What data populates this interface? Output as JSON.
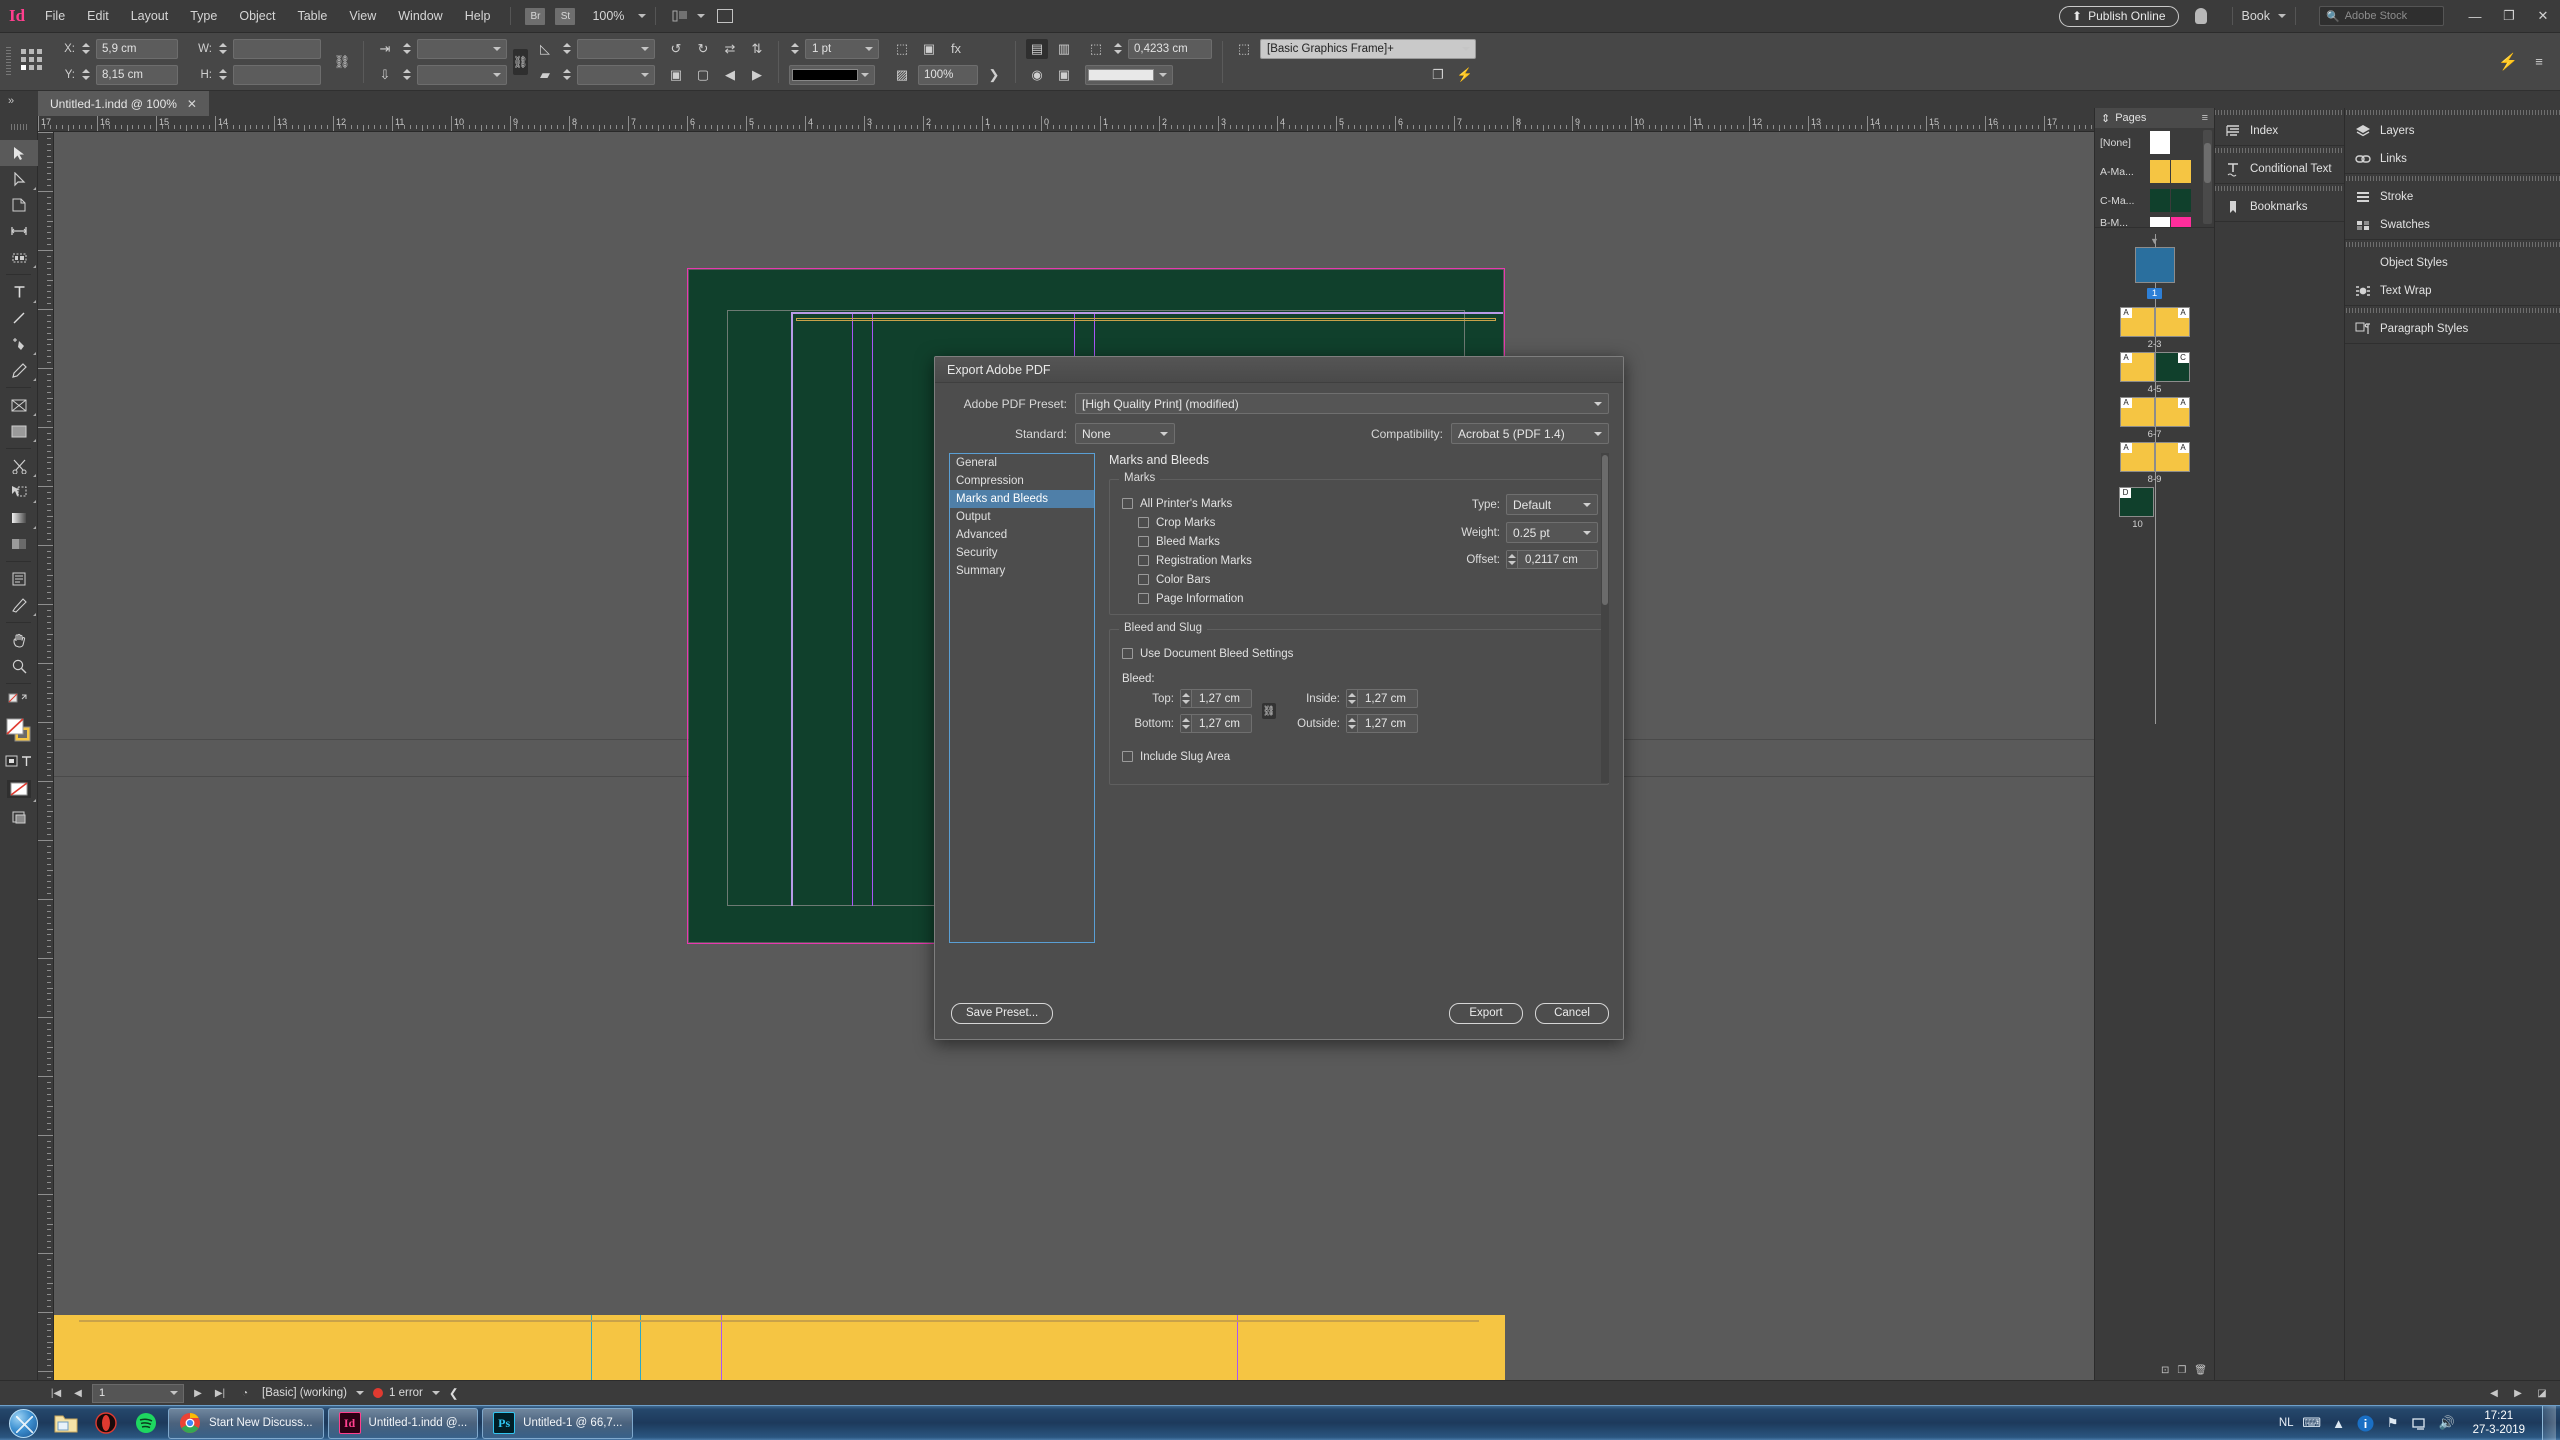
{
  "app": {
    "logo": "Id",
    "menus": [
      "File",
      "Edit",
      "Layout",
      "Type",
      "Object",
      "Table",
      "View",
      "Window",
      "Help"
    ],
    "bridge_label": "Br",
    "stock_label": "St",
    "zoom_level": "100%",
    "publish_button": "Publish Online",
    "workspace": "Book",
    "search_placeholder": "Adobe Stock",
    "window_minimize": "—",
    "window_restore": "❐",
    "window_close": "✕"
  },
  "control_bar": {
    "x_label": "X:",
    "x_value": "5,9 cm",
    "y_label": "Y:",
    "y_value": "8,15 cm",
    "w_label": "W:",
    "w_value": "",
    "h_label": "H:",
    "h_value": "",
    "scale_x": "",
    "scale_y": "",
    "rotation": "",
    "shear": "",
    "stroke_weight": "1 pt",
    "opacity": "100%",
    "corner_radius": "0,4233 cm",
    "object_style": "[Basic Graphics Frame]+",
    "stroke_swatch": "#000000"
  },
  "document_tab": {
    "title": "Untitled-1.indd @ 100%",
    "close": "✕"
  },
  "ruler": {
    "horizontal_labels": [
      "17",
      "16",
      "15",
      "14",
      "13",
      "12",
      "11",
      "10",
      "9",
      "8",
      "7",
      "6",
      "5",
      "4",
      "3",
      "2",
      "1",
      "0",
      "1",
      "2",
      "3",
      "4",
      "5",
      "6",
      "7",
      "8",
      "9",
      "10",
      "11",
      "12",
      "13",
      "14",
      "15",
      "16",
      "17"
    ],
    "unit": "cm"
  },
  "toolbox": {
    "tools": [
      {
        "name": "selection-tool",
        "glyph": "➤"
      },
      {
        "name": "direct-selection-tool",
        "glyph": "◹"
      },
      {
        "name": "page-tool",
        "glyph": "▤"
      },
      {
        "name": "gap-tool",
        "glyph": "↔"
      },
      {
        "name": "content-collector-tool",
        "glyph": "▩"
      },
      {
        "name": "type-tool",
        "glyph": "T"
      },
      {
        "name": "line-tool",
        "glyph": "/"
      },
      {
        "name": "pen-tool",
        "glyph": "✒"
      },
      {
        "name": "pencil-tool",
        "glyph": "✎"
      },
      {
        "name": "rectangle-frame-tool",
        "glyph": "⊠"
      },
      {
        "name": "rectangle-tool",
        "glyph": "▭"
      },
      {
        "name": "scissors-tool",
        "glyph": "✂"
      },
      {
        "name": "free-transform-tool",
        "glyph": "⇲"
      },
      {
        "name": "gradient-swatch-tool",
        "glyph": "▰"
      },
      {
        "name": "gradient-feather-tool",
        "glyph": "▨"
      },
      {
        "name": "note-tool",
        "glyph": "▤"
      },
      {
        "name": "eyedropper-tool",
        "glyph": "⚲"
      },
      {
        "name": "hand-tool",
        "glyph": "✋"
      },
      {
        "name": "zoom-tool",
        "glyph": "⚲"
      }
    ]
  },
  "dialog": {
    "title": "Export Adobe PDF",
    "preset_label": "Adobe PDF Preset:",
    "preset_value": "[High Quality Print] (modified)",
    "standard_label": "Standard:",
    "standard_value": "None",
    "compatibility_label": "Compatibility:",
    "compatibility_value": "Acrobat 5 (PDF 1.4)",
    "nav_items": [
      "General",
      "Compression",
      "Marks and Bleeds",
      "Output",
      "Advanced",
      "Security",
      "Summary"
    ],
    "active_nav": "Marks and Bleeds",
    "pane_title": "Marks and Bleeds",
    "marks_group_label": "Marks",
    "marks": [
      {
        "label": "All Printer's Marks",
        "checked": false,
        "indent": 0
      },
      {
        "label": "Crop Marks",
        "checked": false,
        "indent": 1
      },
      {
        "label": "Bleed Marks",
        "checked": false,
        "indent": 1
      },
      {
        "label": "Registration Marks",
        "checked": false,
        "indent": 1
      },
      {
        "label": "Color Bars",
        "checked": false,
        "indent": 1
      },
      {
        "label": "Page Information",
        "checked": false,
        "indent": 1
      }
    ],
    "type_label": "Type:",
    "type_value": "Default",
    "weight_label": "Weight:",
    "weight_value": "0.25 pt",
    "offset_label": "Offset:",
    "offset_value": "0,2117 cm",
    "bleed_group_label": "Bleed and Slug",
    "use_document_bleed_label": "Use Document Bleed Settings",
    "use_document_bleed_checked": false,
    "bleed_label": "Bleed:",
    "bleed_top_label": "Top:",
    "bleed_top_value": "1,27 cm",
    "bleed_bottom_label": "Bottom:",
    "bleed_bottom_value": "1,27 cm",
    "bleed_inside_label": "Inside:",
    "bleed_inside_value": "1,27 cm",
    "bleed_outside_label": "Outside:",
    "bleed_outside_value": "1,27 cm",
    "chain_glyph": "⛓",
    "include_slug_label": "Include Slug Area",
    "include_slug_checked": false,
    "save_preset_button": "Save Preset...",
    "export_button": "Export",
    "cancel_button": "Cancel"
  },
  "pages_panel": {
    "title": "Pages",
    "masters": [
      {
        "name": "[None]",
        "colors": [
          "#ffffff"
        ]
      },
      {
        "name": "A-Ma...",
        "colors": [
          "#f5c543",
          "#f5c543"
        ]
      },
      {
        "name": "C-Ma...",
        "colors": [
          "#10402c",
          "#10402c"
        ]
      },
      {
        "name": "B-M...",
        "colors": [
          "#ffffff",
          "#ff2d9b"
        ]
      }
    ],
    "spreads": [
      {
        "label": "1",
        "selected": true,
        "pages": [
          {
            "color": "#2a6f9e",
            "tag": ""
          }
        ]
      },
      {
        "label": "2-3",
        "selected": false,
        "pages": [
          {
            "color": "#f5c543",
            "tag": "A"
          },
          {
            "color": "#f5c543",
            "tag": "A"
          }
        ]
      },
      {
        "label": "4-5",
        "selected": false,
        "pages": [
          {
            "color": "#f5c543",
            "tag": "A"
          },
          {
            "color": "#10402c",
            "tag": "C"
          }
        ]
      },
      {
        "label": "6-7",
        "selected": false,
        "pages": [
          {
            "color": "#f5c543",
            "tag": "A"
          },
          {
            "color": "#f5c543",
            "tag": "A"
          }
        ]
      },
      {
        "label": "8-9",
        "selected": false,
        "pages": [
          {
            "color": "#f5c543",
            "tag": "A"
          },
          {
            "color": "#f5c543",
            "tag": "A"
          }
        ]
      },
      {
        "label": "10",
        "selected": false,
        "pages": [
          {
            "color": "#10402c",
            "tag": "D"
          }
        ]
      }
    ]
  },
  "panel_docks": {
    "column_a": [
      {
        "label": "Index",
        "icon": "index-icon"
      },
      {
        "label": "Conditional Text",
        "icon": "conditional-text-icon"
      },
      {
        "label": "Bookmarks",
        "icon": "bookmarks-icon"
      }
    ],
    "column_b_group1": [
      {
        "label": "Layers",
        "icon": "layers-icon"
      },
      {
        "label": "Links",
        "icon": "links-icon"
      }
    ],
    "column_b_group2": [
      {
        "label": "Stroke",
        "icon": "stroke-icon"
      },
      {
        "label": "Swatches",
        "icon": "swatches-icon"
      }
    ],
    "column_b_group3": [
      {
        "label": "Object Styles",
        "icon": "object-styles-icon"
      },
      {
        "label": "Text Wrap",
        "icon": "text-wrap-icon"
      }
    ],
    "column_b_group4": [
      {
        "label": "Paragraph Styles",
        "icon": "paragraph-styles-icon"
      }
    ]
  },
  "status_bar": {
    "page_number": "1",
    "preflight_profile": "[Basic] (working)",
    "error_text": "1 error"
  },
  "taskbar": {
    "quick_launch": [
      {
        "name": "explorer-icon",
        "glyph": "🗂"
      },
      {
        "name": "opera-icon",
        "glyph": "O"
      },
      {
        "name": "spotify-icon",
        "glyph": "♫"
      }
    ],
    "apps": [
      {
        "name": "chrome",
        "label": "Start New Discuss...",
        "badge": "",
        "color": "#4285f4"
      },
      {
        "name": "indesign",
        "label": "Untitled-1.indd @...",
        "badge": "Id",
        "color": "#ff3f8e"
      },
      {
        "name": "photoshop",
        "label": "Untitled-1 @ 66,7...",
        "badge": "Ps",
        "color": "#31c5f0"
      }
    ],
    "language": "NL",
    "time": "17:21",
    "date": "27-3-2019"
  }
}
